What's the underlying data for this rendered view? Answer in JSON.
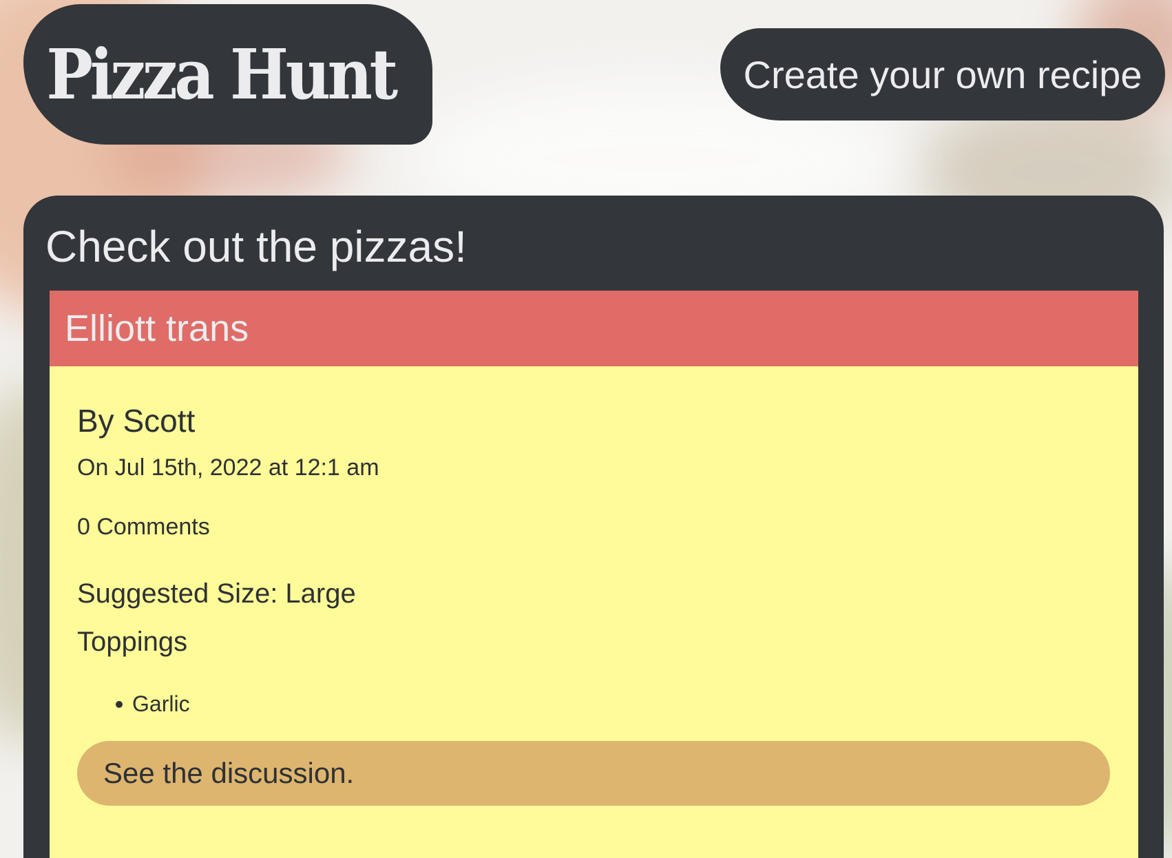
{
  "header": {
    "logo_text": "Pizza Hunt",
    "create_recipe_label": "Create your own recipe"
  },
  "main": {
    "title": "Check out the pizzas!",
    "pizzas": [
      {
        "name": "Elliott trans",
        "author": "By Scott",
        "date": "On Jul 15th, 2022 at 12:1 am",
        "comments": "0 Comments",
        "suggested_size": "Suggested Size: Large",
        "toppings_heading": "Toppings",
        "toppings": [
          "Garlic"
        ],
        "discussion_link": "See the discussion."
      }
    ]
  },
  "colors": {
    "dark": "#33363a",
    "light_text": "#ececee",
    "card_header": "#df6c67",
    "card_body": "#fffb98",
    "discussion_button": "#ddb56f"
  }
}
